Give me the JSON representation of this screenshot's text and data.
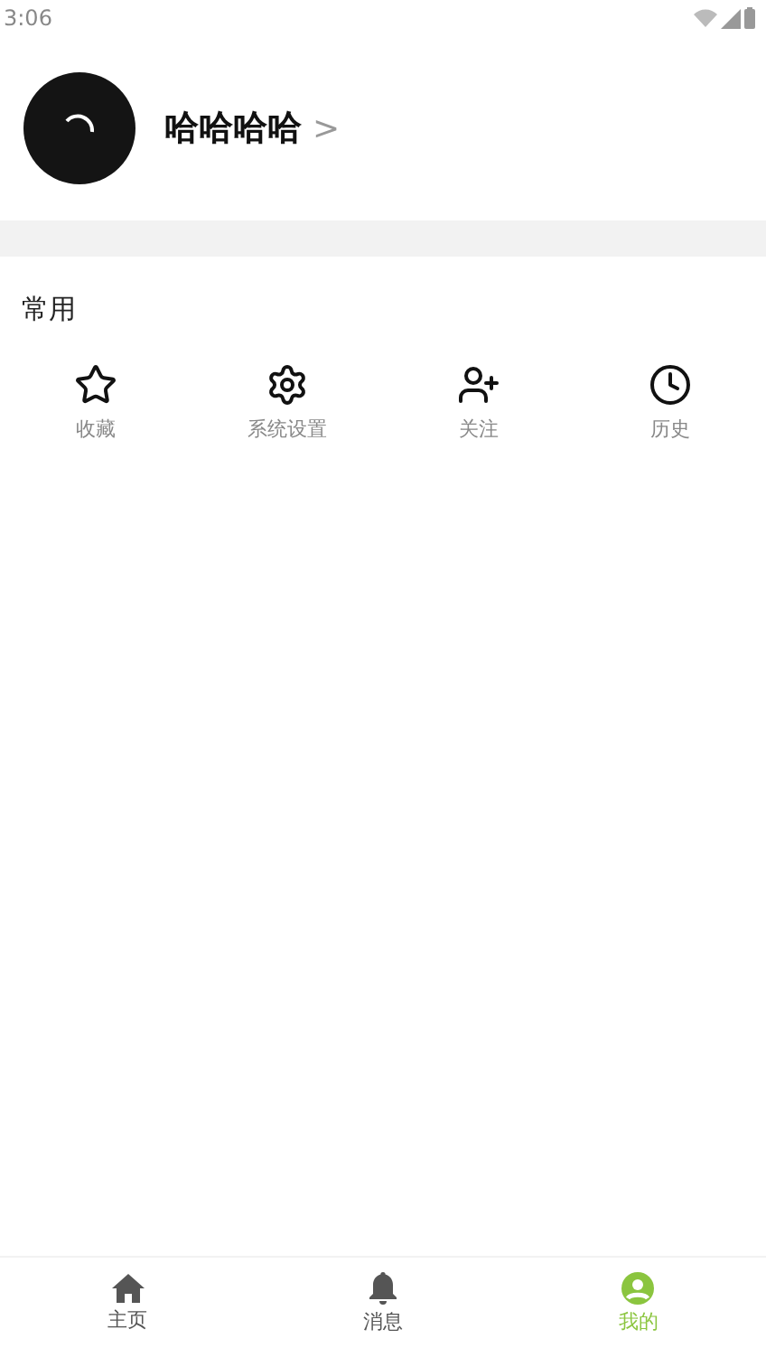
{
  "status_bar": {
    "time": "3:06"
  },
  "profile": {
    "name": "哈哈哈哈",
    "arrow": ">"
  },
  "section": {
    "title": "常用",
    "items": [
      {
        "kind": "star",
        "label": "收藏"
      },
      {
        "kind": "gear",
        "label": "系统设置"
      },
      {
        "kind": "user-plus",
        "label": "关注"
      },
      {
        "kind": "clock",
        "label": "历史"
      }
    ]
  },
  "tabs": [
    {
      "kind": "home",
      "label": "主页",
      "selected": false
    },
    {
      "kind": "bell",
      "label": "消息",
      "selected": false
    },
    {
      "kind": "user",
      "label": "我的",
      "selected": true
    }
  ]
}
